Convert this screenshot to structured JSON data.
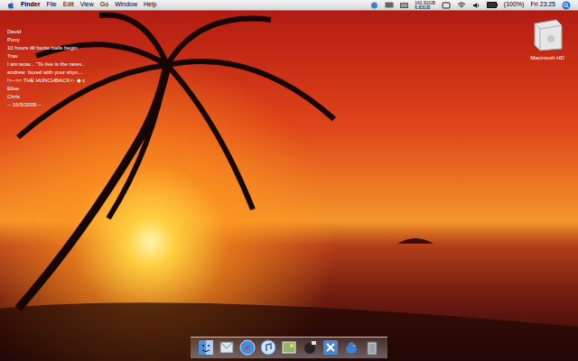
{
  "menu_bar": {
    "app": "Finder",
    "menus": [
      "File",
      "Edit",
      "View",
      "Go",
      "Window",
      "Help"
    ],
    "disk": [
      "141.91GB",
      "6.83GB"
    ],
    "battery": "(100%)",
    "clock": "Fri 23:25"
  },
  "desktop_notes": [
    "David",
    "Pony",
    "10 hours till footto balls begin",
    "Trav",
    "I am wow... \"To live is the rares..",
    "andrew  bored with your shyn...",
    "!>-->> THE HUNCHBACK<- ◆ c",
    "Elise",
    "Chris",
    "-- 16/5/2009 --"
  ],
  "desktop_icons": [
    {
      "label": "Macintosh HD"
    }
  ],
  "dock": [
    {
      "kind": "finder"
    },
    {
      "kind": "mail"
    },
    {
      "kind": "safari"
    },
    {
      "kind": "itunes"
    },
    {
      "kind": "iphoto"
    },
    {
      "kind": "app"
    },
    {
      "kind": "xcode"
    },
    {
      "kind": "adium"
    },
    {
      "kind": "trash"
    }
  ]
}
